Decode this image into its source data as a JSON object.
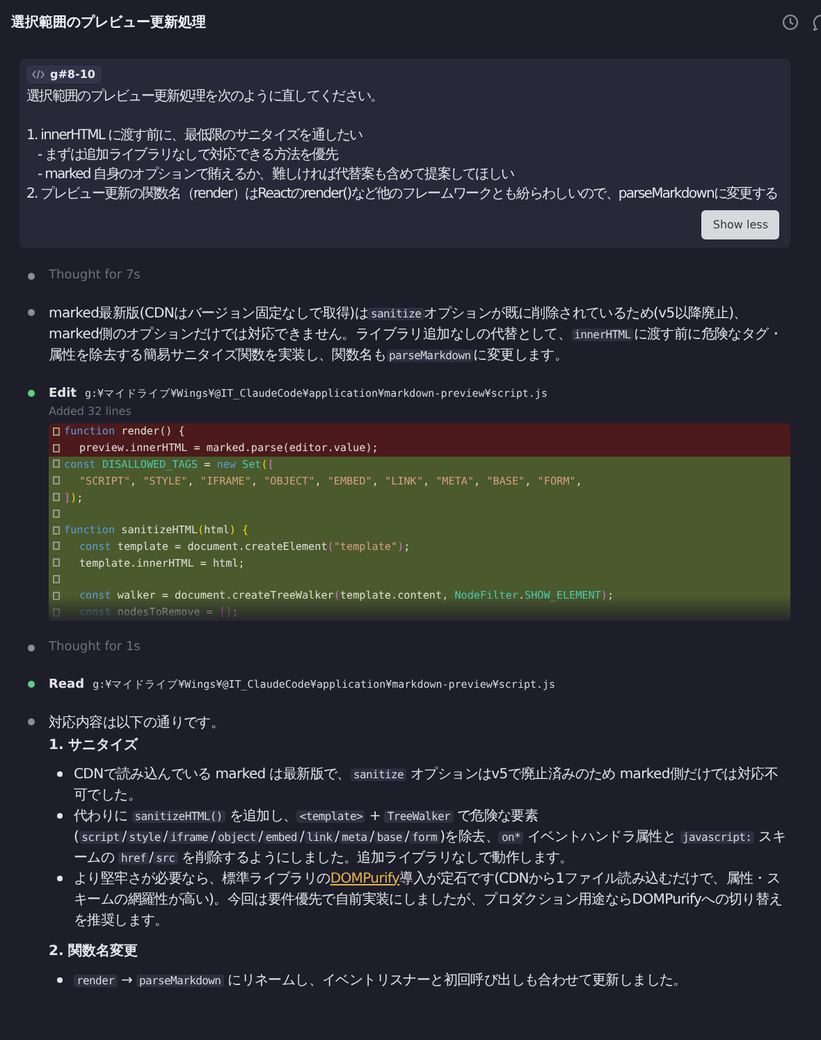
{
  "header": {
    "title": "選択範囲のプレビュー更新処理"
  },
  "prompt": {
    "tag": "g#8-10",
    "intro": "選択範囲のプレビュー更新処理を次のように直してください。",
    "lines": [
      {
        "kind": "item",
        "text": "1. innerHTML に渡す前に、最低限のサニタイズを通したい"
      },
      {
        "kind": "sub",
        "text": "- まずは追加ライブラリなしで対応できる方法を優先"
      },
      {
        "kind": "sub",
        "text": "- marked 自身のオプションで賄えるか、難しければ代替案も含めて提案してほしい"
      },
      {
        "kind": "item",
        "text": "2. プレビュー更新の関数名（render）はReactのrender()など他のフレームワークとも紛らわしいので、parseMarkdownに変更する"
      }
    ],
    "button": "Show less"
  },
  "timeline": [
    {
      "kind": "thought",
      "text": "Thought for 7s"
    },
    {
      "kind": "message",
      "blocks": [
        {
          "kind": "paragraph",
          "segments": [
            {
              "kind": "text",
              "text": "marked最新版(CDNはバージョン固定なしで取得)は"
            },
            {
              "kind": "code",
              "text": "sanitize"
            },
            {
              "kind": "text",
              "text": "オプションが既に削除されているため(v5以降廃止)、marked側のオプションだけでは対応できません。ライブラリ追加なしの代替として、"
            },
            {
              "kind": "code",
              "text": "innerHTML"
            },
            {
              "kind": "text",
              "text": "に渡す前に危険なタグ・属性を除去する簡易サニタイズ関数を実装し、関数名も"
            },
            {
              "kind": "code",
              "text": "parseMarkdown"
            },
            {
              "kind": "text",
              "text": "に変更します。"
            }
          ]
        }
      ]
    },
    {
      "kind": "edit",
      "action": "Edit",
      "path": "g:¥マイドライブ¥Wings¥@IT_ClaudeCode¥application¥markdown-preview¥script.js",
      "note": "Added 32 lines",
      "diff": [
        {
          "kind": "removed",
          "tokens": [
            {
              "kind": "keyword",
              "text": "function"
            },
            {
              "kind": "plain",
              "text": " render() {"
            }
          ]
        },
        {
          "kind": "removed",
          "indented": true,
          "tokens": [
            {
              "kind": "plain",
              "text": "preview.innerHTML = marked.parse(editor.value);"
            }
          ]
        },
        {
          "kind": "added",
          "tokens": [
            {
              "kind": "keyword",
              "text": "const "
            },
            {
              "kind": "name",
              "text": "DISALLOWED_TAGS"
            },
            {
              "kind": "plain",
              "text": " = "
            },
            {
              "kind": "keyword",
              "text": "new "
            },
            {
              "kind": "name",
              "text": "Set"
            },
            {
              "kind": "bracket1",
              "text": "("
            },
            {
              "kind": "bracket2",
              "text": "["
            }
          ]
        },
        {
          "kind": "added",
          "indented": true,
          "tokens": [
            {
              "kind": "string",
              "text": "\"SCRIPT\""
            },
            {
              "kind": "plain",
              "text": ", "
            },
            {
              "kind": "string",
              "text": "\"STYLE\""
            },
            {
              "kind": "plain",
              "text": ", "
            },
            {
              "kind": "string",
              "text": "\"IFRAME\""
            },
            {
              "kind": "plain",
              "text": ", "
            },
            {
              "kind": "string",
              "text": "\"OBJECT\""
            },
            {
              "kind": "plain",
              "text": ", "
            },
            {
              "kind": "string",
              "text": "\"EMBED\""
            },
            {
              "kind": "plain",
              "text": ", "
            },
            {
              "kind": "string",
              "text": "\"LINK\""
            },
            {
              "kind": "plain",
              "text": ", "
            },
            {
              "kind": "string",
              "text": "\"META\""
            },
            {
              "kind": "plain",
              "text": ", "
            },
            {
              "kind": "string",
              "text": "\"BASE\""
            },
            {
              "kind": "plain",
              "text": ", "
            },
            {
              "kind": "string",
              "text": "\"FORM\""
            },
            {
              "kind": "plain",
              "text": ","
            }
          ]
        },
        {
          "kind": "added",
          "tokens": [
            {
              "kind": "bracket2",
              "text": "]"
            },
            {
              "kind": "bracket1",
              "text": ")"
            },
            {
              "kind": "plain",
              "text": ";"
            }
          ]
        },
        {
          "kind": "added"
        },
        {
          "kind": "added",
          "tokens": [
            {
              "kind": "keyword",
              "text": "function"
            },
            {
              "kind": "plain",
              "text": " sanitizeHTML"
            },
            {
              "kind": "bracket1",
              "text": "("
            },
            {
              "kind": "plain",
              "text": "html"
            },
            {
              "kind": "bracket1",
              "text": ") {"
            }
          ]
        },
        {
          "kind": "added",
          "indented": true,
          "tokens": [
            {
              "kind": "keyword",
              "text": "const"
            },
            {
              "kind": "plain",
              "text": " template = document.createElement"
            },
            {
              "kind": "bracket2",
              "text": "("
            },
            {
              "kind": "string",
              "text": "\"template\""
            },
            {
              "kind": "bracket2",
              "text": ")"
            },
            {
              "kind": "plain",
              "text": ";"
            }
          ]
        },
        {
          "kind": "added",
          "indented": true,
          "tokens": [
            {
              "kind": "plain",
              "text": "template.innerHTML = html;"
            }
          ]
        },
        {
          "kind": "added"
        },
        {
          "kind": "added",
          "indented": true,
          "tokens": [
            {
              "kind": "keyword",
              "text": "const"
            },
            {
              "kind": "plain",
              "text": " walker = document.createTreeWalker"
            },
            {
              "kind": "bracket2",
              "text": "("
            },
            {
              "kind": "plain",
              "text": "template.content, "
            },
            {
              "kind": "name",
              "text": "NodeFilter"
            },
            {
              "kind": "plain",
              "text": "."
            },
            {
              "kind": "name",
              "text": "SHOW_ELEMENT"
            },
            {
              "kind": "bracket2",
              "text": ")"
            },
            {
              "kind": "plain",
              "text": ";"
            }
          ]
        },
        {
          "kind": "added",
          "indented": true,
          "tokens": [
            {
              "kind": "keyword",
              "text": "const"
            },
            {
              "kind": "plain",
              "text": " nodesToRemove = "
            },
            {
              "kind": "bracket2",
              "text": "[]"
            },
            {
              "kind": "plain",
              "text": ";"
            }
          ]
        }
      ]
    },
    {
      "kind": "thought",
      "text": "Thought for 1s"
    },
    {
      "kind": "read",
      "action": "Read",
      "path": "g:¥マイドライブ¥Wings¥@IT_ClaudeCode¥application¥markdown-preview¥script.js"
    },
    {
      "kind": "message",
      "blocks": [
        {
          "kind": "paragraph",
          "segments": [
            {
              "kind": "text",
              "text": "対応内容は以下の通りです。"
            }
          ]
        },
        {
          "kind": "heading",
          "text": "1. サニタイズ"
        },
        {
          "kind": "bullets",
          "items": [
            [
              {
                "kind": "text",
                "text": "CDNで読み込んでいる marked は最新版で、"
              },
              {
                "kind": "code",
                "text": "sanitize"
              },
              {
                "kind": "text",
                "text": " オプションはv5で廃止済みのため marked側だけでは対応不可でした。"
              }
            ],
            [
              {
                "kind": "text",
                "text": "代わりに "
              },
              {
                "kind": "code",
                "text": "sanitizeHTML()"
              },
              {
                "kind": "text",
                "text": " を追加し、"
              },
              {
                "kind": "code",
                "text": "<template>"
              },
              {
                "kind": "text",
                "text": " + "
              },
              {
                "kind": "code",
                "text": "TreeWalker"
              },
              {
                "kind": "text",
                "text": " で危険な要素 ("
              },
              {
                "kind": "code",
                "text": "script"
              },
              {
                "kind": "text",
                "text": "/"
              },
              {
                "kind": "code",
                "text": "style"
              },
              {
                "kind": "text",
                "text": "/"
              },
              {
                "kind": "code",
                "text": "iframe"
              },
              {
                "kind": "text",
                "text": "/"
              },
              {
                "kind": "code",
                "text": "object"
              },
              {
                "kind": "text",
                "text": "/"
              },
              {
                "kind": "code",
                "text": "embed"
              },
              {
                "kind": "text",
                "text": "/"
              },
              {
                "kind": "code",
                "text": "link"
              },
              {
                "kind": "text",
                "text": "/"
              },
              {
                "kind": "code",
                "text": "meta"
              },
              {
                "kind": "text",
                "text": "/"
              },
              {
                "kind": "code",
                "text": "base"
              },
              {
                "kind": "text",
                "text": "/"
              },
              {
                "kind": "code",
                "text": "form"
              },
              {
                "kind": "text",
                "text": ")を除去、"
              },
              {
                "kind": "code",
                "text": "on*"
              },
              {
                "kind": "text",
                "text": " イベントハンドラ属性と "
              },
              {
                "kind": "code",
                "text": "javascript:"
              },
              {
                "kind": "text",
                "text": " スキームの "
              },
              {
                "kind": "code",
                "text": "href"
              },
              {
                "kind": "text",
                "text": "/"
              },
              {
                "kind": "code",
                "text": "src"
              },
              {
                "kind": "text",
                "text": " を削除するようにしました。追加ライブラリなしで動作します。"
              }
            ],
            [
              {
                "kind": "text",
                "text": "より堅牢さが必要なら、標準ライブラリの"
              },
              {
                "kind": "link",
                "text": "DOMPurify"
              },
              {
                "kind": "text",
                "text": "導入が定石です(CDNから1ファイル読み込むだけで、属性・スキームの網羅性が高い)。今回は要件優先で自前実装にしましたが、プロダクション用途ならDOMPurifyへの切り替えを推奨します。"
              }
            ]
          ]
        },
        {
          "kind": "heading",
          "text": "2. 関数名変更"
        },
        {
          "kind": "bullets",
          "items": [
            [
              {
                "kind": "code",
                "text": "render"
              },
              {
                "kind": "text",
                "text": " → "
              },
              {
                "kind": "code",
                "text": "parseMarkdown"
              },
              {
                "kind": "text",
                "text": " にリネームし、イベントリスナーと初回呼び出しも合わせて更新しました。"
              }
            ]
          ]
        }
      ]
    }
  ]
}
